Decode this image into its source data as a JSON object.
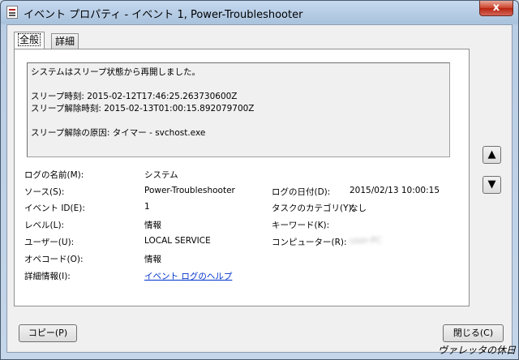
{
  "window": {
    "title": "イベント プロパティ - イベント 1, Power-Troubleshooter",
    "close_label": "x"
  },
  "tabs": [
    {
      "label": "全般",
      "active": true
    },
    {
      "label": "詳細",
      "active": false
    }
  ],
  "description": "システムはスリープ状態から再開しました。\n\nスリープ時刻: 2015-02-12T17:46:25.263730600Z\nスリープ解除時刻: 2015-02-13T01:00:15.892079700Z\n\nスリープ解除の原因: タイマー - svchost.exe",
  "fields": {
    "log_name_label": "ログの名前(M):",
    "log_name_value": "システム",
    "source_label": "ソース(S):",
    "source_value": "Power-Troubleshooter",
    "logged_label": "ログの日付(D):",
    "logged_value": "2015/02/13 10:00:15",
    "event_id_label": "イベント ID(E):",
    "event_id_value": "1",
    "task_category_label": "タスクのカテゴリ(Y):",
    "task_category_value": "なし",
    "level_label": "レベル(L):",
    "level_value": "情報",
    "keywords_label": "キーワード(K):",
    "keywords_value": "",
    "user_label": "ユーザー(U):",
    "user_value": "LOCAL SERVICE",
    "computer_label": "コンピューター(R):",
    "computer_value": "user-PC",
    "opcode_label": "オペコード(O):",
    "opcode_value": "情報",
    "more_info_label": "詳細情報(I):",
    "more_info_link": "イベント ログのヘルプ"
  },
  "buttons": {
    "up_arrow": "▲",
    "down_arrow": "▼",
    "copy": "コピー(P)",
    "close": "閉じる(C)"
  },
  "watermark": "ヴァレッタの休日"
}
